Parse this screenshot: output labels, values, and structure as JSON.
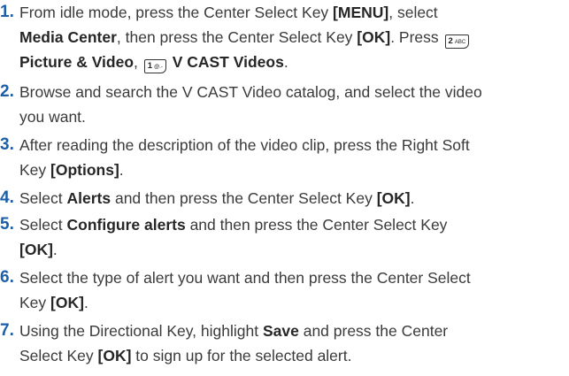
{
  "steps": [
    {
      "num": "1.",
      "lines": [
        [
          "From idle mode, press the Center Select Key ",
          "[MENU]",
          ", select"
        ],
        [
          "Media Center",
          ", then press the Center Select Key ",
          "[OK]",
          ". Press "
        ],
        [
          "Picture & Video",
          ", ",
          "V CAST Videos",
          "."
        ]
      ],
      "keys": [
        {
          "label": "2",
          "sub": "ABC"
        },
        {
          "label": "1",
          "sub": "@.-"
        }
      ]
    },
    {
      "num": "2.",
      "lines": [
        [
          "Browse and search the V CAST Video catalog, and select the video"
        ],
        [
          "you want."
        ]
      ]
    },
    {
      "num": "3.",
      "lines": [
        [
          "After reading the description of the video clip, press the Right Soft"
        ],
        [
          "Key ",
          "[Options]",
          "."
        ]
      ]
    },
    {
      "num": "4.",
      "lines": [
        [
          "Select ",
          "Alerts",
          " and then press the Center Select Key ",
          "[OK]",
          "."
        ]
      ]
    },
    {
      "num": "5.",
      "lines": [
        [
          "Select ",
          "Configure alerts",
          " and then press the Center Select Key"
        ],
        [
          "[OK]",
          "."
        ]
      ]
    },
    {
      "num": "6.",
      "lines": [
        [
          "Select the type of alert you want and then press the Center Select"
        ],
        [
          "Key ",
          "[OK]",
          "."
        ]
      ]
    },
    {
      "num": "7.",
      "lines": [
        [
          "Using the Directional Key, highlight ",
          "Save",
          " and press the Center"
        ],
        [
          "Select Key ",
          "[OK]",
          " to sign up for the selected alert."
        ]
      ]
    }
  ]
}
